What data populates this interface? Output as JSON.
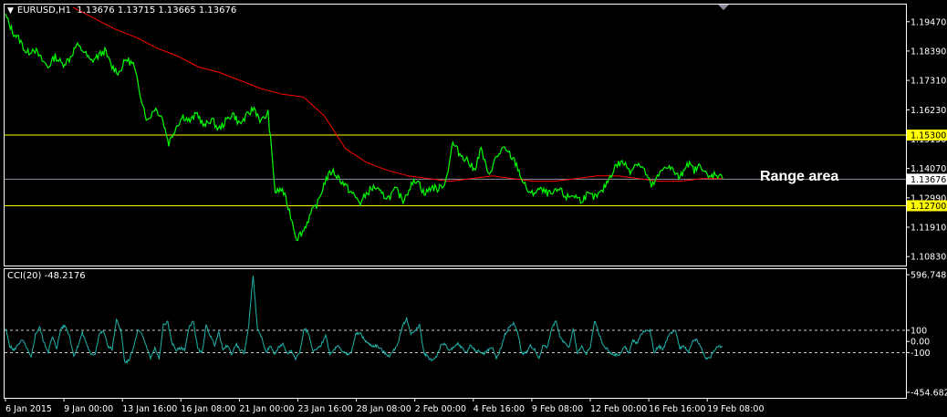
{
  "header": {
    "symbol_timeframe": "EURUSD,H1",
    "ohlc": "1.13676 1.13715 1.13665 1.13676"
  },
  "annotation": "Range area",
  "indicator": {
    "label": "CCI(20) -48.2176"
  },
  "colors": {
    "background": "#000000",
    "price_line": "#00ff00",
    "moving_average": "#ff0000",
    "level_lines": "#ffff00",
    "current_price_line": "#8a8fa0",
    "cci_line": "#20b2aa",
    "grid_border": "#ffffff"
  },
  "chart_data": [
    {
      "type": "line",
      "title": "EURUSD,H1",
      "y_ticks": [
        "1.19470",
        "1.18390",
        "1.17310",
        "1.16230",
        "1.15150",
        "1.14070",
        "1.12990",
        "1.11910",
        "1.10830"
      ],
      "ylim": [
        1.105,
        1.201
      ],
      "x_ticks": [
        "6 Jan 2015",
        "9 Jan 00:00",
        "13 Jan 16:00",
        "16 Jan 08:00",
        "21 Jan 00:00",
        "23 Jan 16:00",
        "28 Jan 08:00",
        "2 Feb 00:00",
        "4 Feb 16:00",
        "9 Feb 08:00",
        "12 Feb 00:00",
        "16 Feb 16:00",
        "19 Feb 08:00"
      ],
      "horizontal_levels": [
        {
          "value": 1.153,
          "label": "1.15300"
        },
        {
          "value": 1.127,
          "label": "1.12700"
        }
      ],
      "current_price": {
        "value": 1.13676,
        "label": "1.13676"
      },
      "series": [
        {
          "values": [
            1.197,
            1.191,
            1.188,
            1.183,
            1.185,
            1.181,
            1.178,
            1.182,
            1.179,
            1.181,
            1.186,
            1.184,
            1.18,
            1.182,
            1.184,
            1.178,
            1.176,
            1.181,
            1.179,
            1.168,
            1.158,
            1.163,
            1.16,
            1.15,
            1.156,
            1.16,
            1.158,
            1.161,
            1.156,
            1.159,
            1.155,
            1.158,
            1.161,
            1.157,
            1.16,
            1.163,
            1.158,
            1.161,
            1.132,
            1.133,
            1.125,
            1.115,
            1.118,
            1.124,
            1.128,
            1.136,
            1.14,
            1.137,
            1.134,
            1.131,
            1.128,
            1.132,
            1.134,
            1.131,
            1.13,
            1.133,
            1.129,
            1.134,
            1.137,
            1.131,
            1.134,
            1.133,
            1.136,
            1.15,
            1.146,
            1.144,
            1.14,
            1.148,
            1.138,
            1.144,
            1.148,
            1.146,
            1.142,
            1.135,
            1.131,
            1.133,
            1.132,
            1.131,
            1.133,
            1.13,
            1.131,
            1.129,
            1.131,
            1.13,
            1.132,
            1.137,
            1.142,
            1.143,
            1.14,
            1.143,
            1.14,
            1.134,
            1.138,
            1.142,
            1.14,
            1.137,
            1.143,
            1.14,
            1.142,
            1.137,
            1.139,
            1.137
          ]
        },
        {
          "values": [
            1.2,
            1.196,
            1.192,
            1.189,
            1.185,
            1.182,
            1.178,
            1.176,
            1.173,
            1.17,
            1.168,
            1.167,
            1.16,
            1.148,
            1.143,
            1.14,
            1.138,
            1.137,
            1.136,
            1.137,
            1.138,
            1.137,
            1.136,
            1.136,
            1.137,
            1.138,
            1.138,
            1.137,
            1.136,
            1.136,
            1.137,
            1.137
          ]
        }
      ]
    },
    {
      "type": "line",
      "title": "CCI(20) -48.2176",
      "y_ticks": [
        "596.7485",
        "100",
        "0.00",
        "-100",
        "-454.6828"
      ],
      "ylim": [
        -454.6828,
        596.7485
      ],
      "levels": [
        100,
        -100
      ],
      "series": [
        {
          "values": [
            120,
            -40,
            -80,
            -20,
            10,
            -60,
            -150,
            60,
            130,
            -10,
            -90,
            40,
            -60,
            120,
            140,
            50,
            -130,
            -40,
            80,
            -20,
            -120,
            -110,
            70,
            90,
            -40,
            -70,
            190,
            110,
            -200,
            -160,
            -60,
            100,
            60,
            -40,
            -150,
            -60,
            -160,
            150,
            170,
            -10,
            -80,
            -60,
            -70,
            120,
            190,
            -60,
            -110,
            140,
            50,
            -30,
            80,
            -80,
            -30,
            -120,
            -20,
            -80,
            -100,
            150,
            596,
            120,
            40,
            -100,
            -40,
            -120,
            -50,
            -20,
            -110,
            -80,
            -150,
            -90,
            120,
            70,
            -90,
            -70,
            -30,
            60,
            -110,
            -70,
            -30,
            -90,
            -120,
            -100,
            60,
            80,
            20,
            -20,
            -40,
            -40,
            -70,
            -110,
            -130,
            -80,
            -10,
            140,
            200,
            70,
            90,
            150,
            -100,
            -140,
            -170,
            -130,
            -40,
            -20,
            -80,
            -60,
            -20,
            -60,
            -100,
            -30,
            -80,
            -90,
            -110,
            -80,
            -50,
            -150,
            -70,
            60,
            130,
            160,
            80,
            -110,
            -100,
            -40,
            -70,
            -150,
            -30,
            -50,
            130,
            180,
            30,
            -10,
            -60,
            110,
            -100,
            -50,
            -110,
            -60,
            190,
            80,
            -40,
            -70,
            -120,
            -120,
            -120,
            -40,
            -100,
            10,
            -20,
            70,
            100,
            100,
            -100,
            -40,
            -70,
            20,
            80,
            100,
            -60,
            -40,
            -100,
            0,
            20,
            -60,
            -150,
            -150,
            -80,
            -40,
            -48
          ]
        }
      ]
    }
  ]
}
